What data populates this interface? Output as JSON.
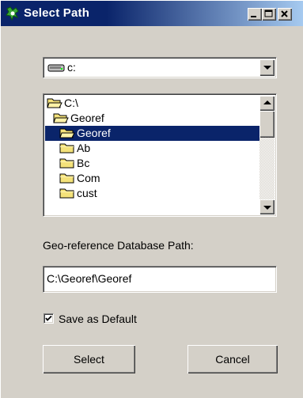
{
  "window": {
    "title": "Select Path",
    "controls": [
      "minimize",
      "maximize",
      "close"
    ]
  },
  "drive": {
    "selected": "c:",
    "icon": "drive-icon"
  },
  "tree": {
    "items": [
      {
        "label": "C:\\",
        "icon": "open-folder-icon",
        "selected": false
      },
      {
        "label": "Georef",
        "icon": "open-folder-icon",
        "selected": false
      },
      {
        "label": "Georef",
        "icon": "open-folder-icon",
        "selected": true
      },
      {
        "label": "Ab",
        "icon": "folder-icon",
        "selected": false
      },
      {
        "label": "Bc",
        "icon": "folder-icon",
        "selected": false
      },
      {
        "label": "Com",
        "icon": "folder-icon",
        "selected": false
      },
      {
        "label": "cust",
        "icon": "folder-icon",
        "selected": false
      }
    ]
  },
  "path": {
    "label": "Geo-reference Database Path:",
    "value": "C:\\Georef\\Georef"
  },
  "save_default": {
    "label": "Save as Default",
    "checked": true
  },
  "buttons": {
    "select": "Select",
    "cancel": "Cancel"
  },
  "colors": {
    "title_start": "#0a246a",
    "title_end": "#a6caf0",
    "face": "#d4d0c8",
    "selection": "#0a246a"
  }
}
